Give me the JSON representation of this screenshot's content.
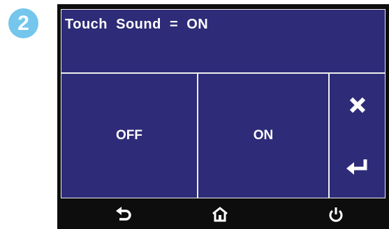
{
  "step_badge": "2",
  "screen": {
    "title": "Touch  Sound  =  ON",
    "options": {
      "off_label": "OFF",
      "on_label": "ON"
    },
    "side_buttons": {
      "cancel_icon": "close-icon",
      "enter_icon": "enter-return-icon"
    }
  },
  "nav_bar": {
    "back_icon": "back-arrow-icon",
    "home_icon": "home-icon",
    "power_icon": "power-icon"
  },
  "colors": {
    "screen_bg": "#2e2b78",
    "badge_bg": "#74c6ec",
    "bezel": "#0d0d0d",
    "text": "#ffffff"
  }
}
